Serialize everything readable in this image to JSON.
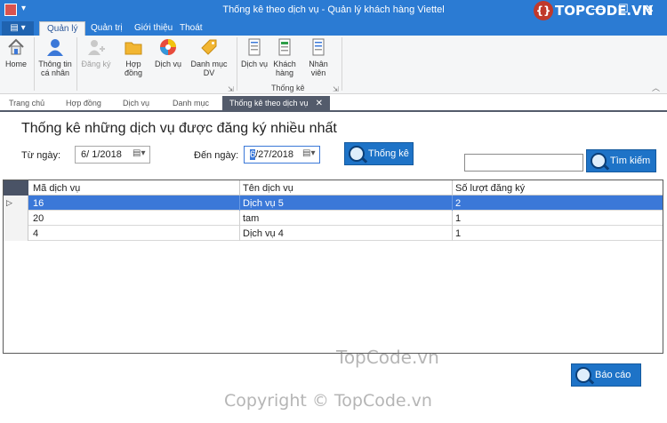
{
  "window": {
    "title": "Thống kê theo dịch vụ - Quản lý khách hàng Viettel",
    "min_glyph": "—",
    "max_glyph": "☐",
    "close_glyph": "✕",
    "logo_text": "TOPCODE.VN"
  },
  "ribbon_tabs": {
    "file_label": "▤ ▾",
    "tabs": [
      "Quản lý",
      "Quản trị",
      "Giới thiệu",
      "Thoát"
    ]
  },
  "ribbon": {
    "buttons": {
      "home": "Home",
      "personal_info": "Thông tin cá nhân",
      "register": "Đăng ký",
      "contract": "Hợp đồng",
      "service": "Dịch vụ",
      "service_list": "Danh mục DV",
      "stat_service": "Dịch vụ",
      "stat_customer": "Khách hàng",
      "stat_staff": "Nhân viên"
    },
    "group_statistics": "Thống kê"
  },
  "doc_tabs": {
    "tabs": [
      "Trang chủ",
      "Hợp đồng",
      "Dịch vụ",
      "Danh mục"
    ],
    "active": "Thống kê theo dịch vụ",
    "close_glyph": "✕"
  },
  "form": {
    "heading": "Thống kê những dịch vụ được đăng ký nhiều nhất",
    "from_label": "Từ ngày:",
    "from_value": "6/ 1/2018",
    "to_label": "Đến ngày:",
    "to_month": "6",
    "to_rest": "/27/2018",
    "stat_button": "Thống kê",
    "search_value": "",
    "search_button": "Tìm kiếm",
    "report_button": "Báo cáo"
  },
  "grid": {
    "columns": [
      "Mã dịch vụ",
      "Tên dịch vụ",
      "Số lượt đăng ký"
    ],
    "rows": [
      [
        "16",
        "Dịch vụ 5",
        "2"
      ],
      [
        "20",
        "tam",
        "1"
      ],
      [
        "4",
        "Dịch vụ 4",
        "1"
      ]
    ],
    "current_row_marker": "▷"
  },
  "watermarks": {
    "center": "TopCode.vn",
    "footer": "Copyright © TopCode.vn"
  }
}
